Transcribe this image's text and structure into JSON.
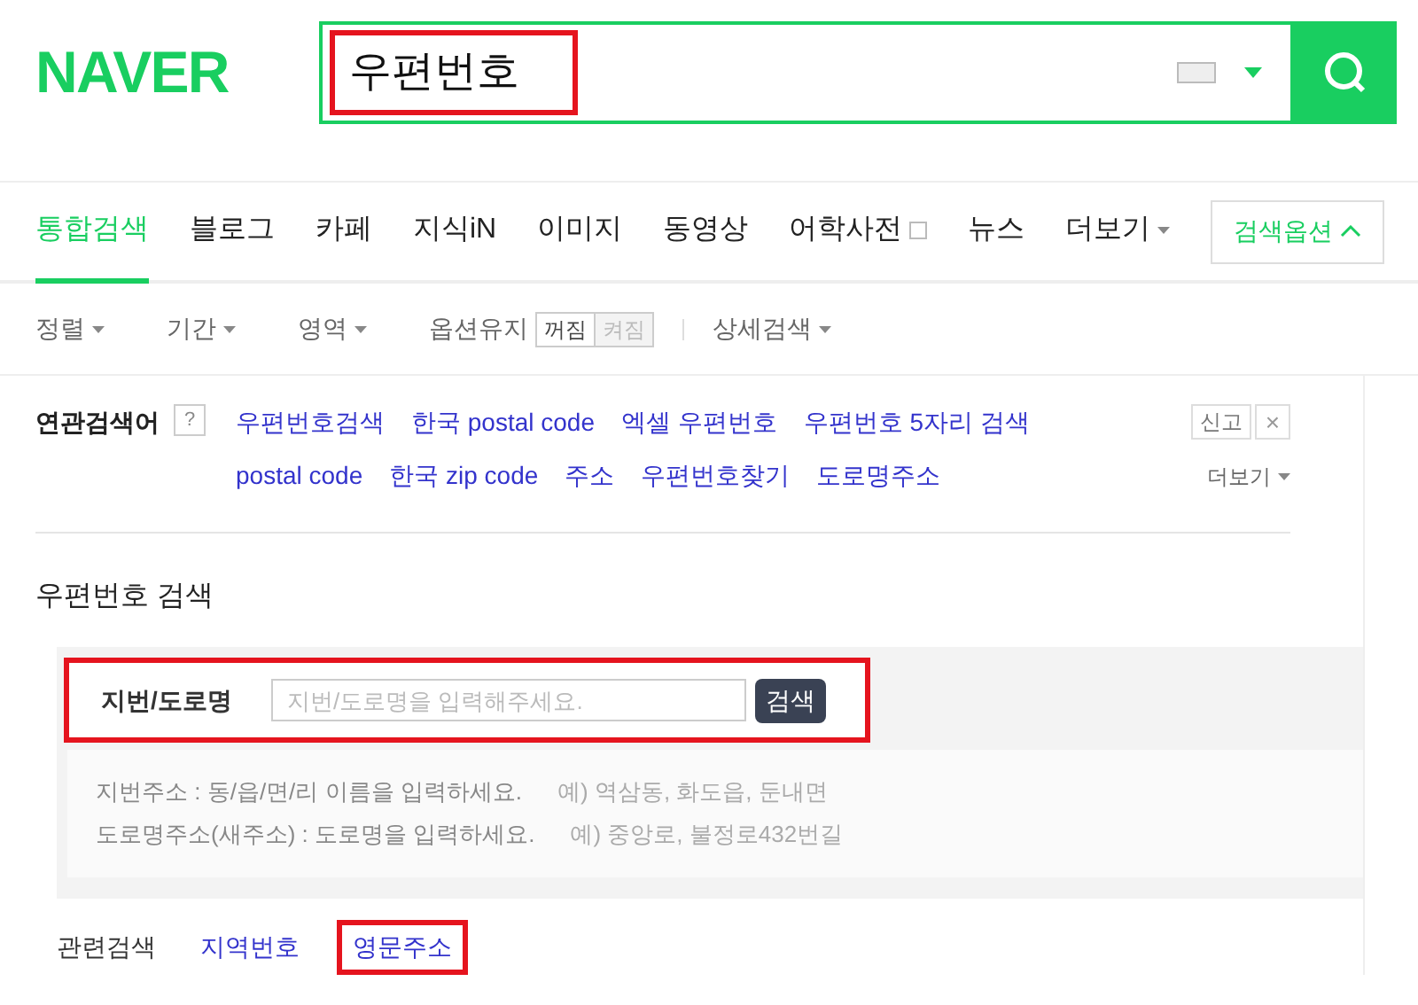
{
  "logo": "NAVER",
  "search": {
    "value": "우편번호",
    "highlighted": true
  },
  "tabs": [
    {
      "label": "통합검색",
      "selected": true,
      "kind": "plain"
    },
    {
      "label": "블로그",
      "selected": false,
      "kind": "plain"
    },
    {
      "label": "카페",
      "selected": false,
      "kind": "plain"
    },
    {
      "label": "지식iN",
      "selected": false,
      "kind": "plain"
    },
    {
      "label": "이미지",
      "selected": false,
      "kind": "plain"
    },
    {
      "label": "동영상",
      "selected": false,
      "kind": "plain"
    },
    {
      "label": "어학사전",
      "selected": false,
      "kind": "external"
    },
    {
      "label": "뉴스",
      "selected": false,
      "kind": "plain"
    },
    {
      "label": "더보기",
      "selected": false,
      "kind": "dropdown"
    }
  ],
  "options_button": "검색옵션",
  "filters": [
    {
      "label": "정렬"
    },
    {
      "label": "기간"
    },
    {
      "label": "영역"
    }
  ],
  "option_keep": {
    "label": "옵션유지",
    "off": "꺼짐",
    "on": "켜짐",
    "enabled": false
  },
  "detail_search": "상세검색",
  "related_keywords": {
    "label": "연관검색어",
    "help": "?",
    "report": "신고",
    "close": "×",
    "more": "더보기",
    "keywords": [
      "우편번호검색",
      "한국 postal code",
      "엑셀 우편번호",
      "우편번호 5자리 검색",
      "postal code",
      "한국 zip code",
      "주소",
      "우편번호찾기",
      "도로명주소"
    ]
  },
  "zip_search": {
    "title": "우편번호 검색",
    "label": "지번/도로명",
    "placeholder": "지번/도로명을 입력해주세요.",
    "button": "검색",
    "highlighted": true,
    "hints": [
      {
        "text": "지번주소 : 동/읍/면/리 이름을 입력하세요.",
        "example": "예) 역삼동, 화도읍, 둔내면"
      },
      {
        "text": "도로명주소(새주소) : 도로명을 입력하세요.",
        "example": "예) 중앙로, 불정로432번길"
      }
    ]
  },
  "related_search": {
    "label": "관련검색",
    "links": [
      {
        "text": "지역번호",
        "highlighted": false
      },
      {
        "text": "영문주소",
        "highlighted": true
      }
    ]
  }
}
